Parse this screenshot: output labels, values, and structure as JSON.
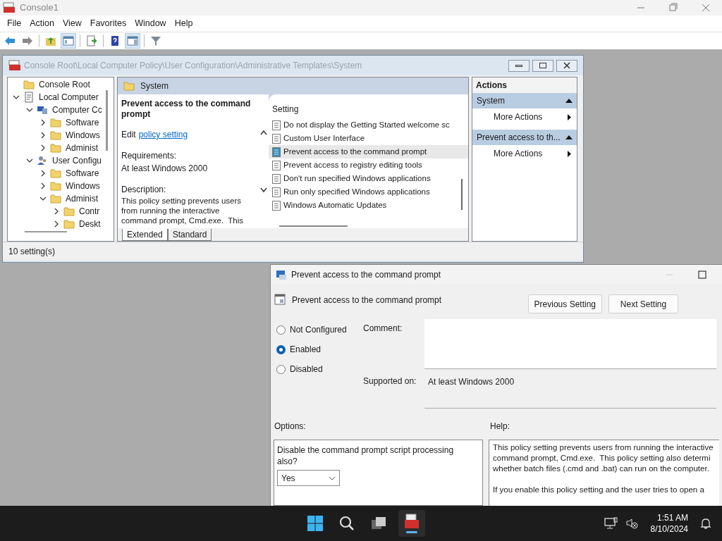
{
  "app": {
    "title": "Console1"
  },
  "menu": [
    "File",
    "Action",
    "View",
    "Favorites",
    "Window",
    "Help"
  ],
  "toolbar": [
    {
      "kind": "back",
      "pressed": false
    },
    {
      "kind": "forward",
      "pressed": false
    },
    {
      "kind": "sep"
    },
    {
      "kind": "up",
      "pressed": false
    },
    {
      "kind": "tree",
      "pressed": true
    },
    {
      "kind": "sep"
    },
    {
      "kind": "export",
      "pressed": false
    },
    {
      "kind": "sep"
    },
    {
      "kind": "help",
      "pressed": false
    },
    {
      "kind": "pane",
      "pressed": true
    },
    {
      "kind": "sep"
    },
    {
      "kind": "filter",
      "pressed": false
    }
  ],
  "mdi_window": {
    "title": "Console Root\\Local Computer Policy\\User Configuration\\Administrative Templates\\System",
    "tree": [
      {
        "label": "Console Root",
        "kind": "folder"
      },
      {
        "label": "Local Computer",
        "kind": "policy",
        "expanded": true,
        "children": [
          {
            "label": "Computer Cc",
            "kind": "computer",
            "expanded": true,
            "children": [
              {
                "label": "Software",
                "kind": "folder",
                "expanded": false
              },
              {
                "label": "Windows",
                "kind": "folder",
                "expanded": false
              },
              {
                "label": "Administ",
                "kind": "folder",
                "expanded": false
              }
            ]
          },
          {
            "label": "User Configu",
            "kind": "user",
            "expanded": true,
            "children": [
              {
                "label": "Software",
                "kind": "folder",
                "expanded": false
              },
              {
                "label": "Windows",
                "kind": "folder",
                "expanded": false
              },
              {
                "label": "Administ",
                "kind": "folder",
                "expanded": true,
                "children": [
                  {
                    "label": "Contr",
                    "kind": "folder",
                    "expanded": false
                  },
                  {
                    "label": "Deskt",
                    "kind": "folder",
                    "expanded": false
                  }
                ]
              }
            ]
          }
        ]
      }
    ],
    "header": "System",
    "detail": {
      "policy_title": "Prevent access to the command prompt",
      "edit_prefix": "Edit",
      "edit_link": "policy setting",
      "requirements_label": "Requirements:",
      "requirements_value": "At least Windows 2000",
      "description_label": "Description:",
      "description": "This policy setting prevents users from running the interactive command prompt, Cmd.exe.  This"
    },
    "settings_column": "Setting",
    "settings": [
      {
        "label": "Do not display the Getting Started welcome sc",
        "selected": false
      },
      {
        "label": "Custom User Interface",
        "selected": false
      },
      {
        "label": "Prevent access to the command prompt",
        "selected": true
      },
      {
        "label": "Prevent access to registry editing tools",
        "selected": false
      },
      {
        "label": "Don't run specified Windows applications",
        "selected": false
      },
      {
        "label": "Run only specified Windows applications",
        "selected": false
      },
      {
        "label": "Windows Automatic Updates",
        "selected": false
      }
    ],
    "view_tabs": [
      {
        "label": "Extended",
        "selected": true
      },
      {
        "label": "Standard",
        "selected": false
      }
    ],
    "actions": {
      "title": "Actions",
      "sections": [
        {
          "title": "System",
          "items": [
            "More Actions"
          ]
        },
        {
          "title": "Prevent access to th...",
          "items": [
            "More Actions"
          ]
        }
      ]
    },
    "status": "10 setting(s)"
  },
  "dialog": {
    "title": "Prevent access to the command prompt",
    "setting_title": "Prevent access to the command prompt",
    "buttons": [
      "Previous Setting",
      "Next Setting"
    ],
    "states": [
      {
        "label": "Not Configured",
        "selected": false
      },
      {
        "label": "Enabled",
        "selected": true
      },
      {
        "label": "Disabled",
        "selected": false
      }
    ],
    "comment_label": "Comment:",
    "supported_label": "Supported on:",
    "supported_value": "At least Windows 2000",
    "options_label": "Options:",
    "help_label": "Help:",
    "option_prompt": "Disable the command prompt script processing also?",
    "option_value": "Yes",
    "help_paragraphs": [
      [
        "This policy setting prevents users from running the interactive",
        "command prompt, Cmd.exe.  This policy setting also determi",
        "whether batch files (.cmd and .bat) can run on the computer."
      ],
      [
        "If you enable this policy setting and the user tries to open a"
      ]
    ]
  },
  "taskbar": {
    "time": "1:51 AM",
    "date": "8/10/2024"
  }
}
